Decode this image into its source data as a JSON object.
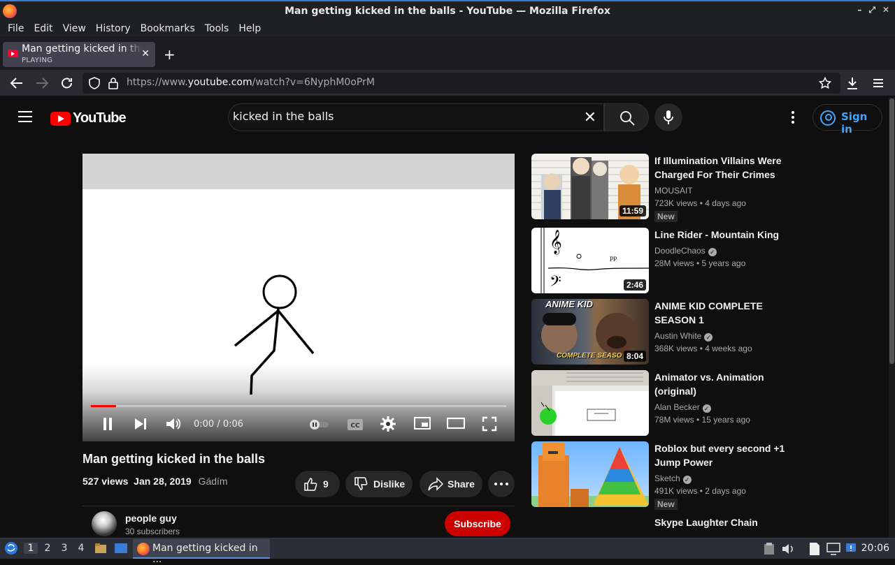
{
  "window": {
    "title": "Man getting kicked in the balls - YouTube — Mozilla Firefox",
    "controls": [
      "–",
      "⤢",
      "✕"
    ]
  },
  "menubar": [
    {
      "label": "File"
    },
    {
      "label": "Edit"
    },
    {
      "label": "View"
    },
    {
      "label": "History"
    },
    {
      "label": "Bookmarks"
    },
    {
      "label": "Tools"
    },
    {
      "label": "Help"
    }
  ],
  "tab": {
    "title": "Man getting kicked in the balls - YouTube",
    "status": "PLAYING",
    "close": "✕",
    "new_tab": "+"
  },
  "navbar": {
    "url_prefix": "https://www.",
    "url_domain": "youtube.com",
    "url_path": "/watch?v=6NyphM0oPrM"
  },
  "youtube": {
    "logo_text": "YouTube",
    "search_value": "kicked in the balls",
    "search_placeholder": "Search",
    "clear": "✕",
    "signin": "Sign in"
  },
  "player": {
    "time": "0:00 / 0:06",
    "progress": 0.06
  },
  "video": {
    "title": "Man getting kicked in the balls",
    "views": "527 views",
    "date": "Jan 28, 2019",
    "tag": "Gádím",
    "likes": "9",
    "dislike": "Dislike",
    "share": "Share"
  },
  "channel": {
    "name": "people guy",
    "subscribers": "30 subscribers",
    "subscribe": "Subscribe"
  },
  "recommendations": [
    {
      "title": "If Illumination Villains Were Charged For Their Crimes",
      "channel": "MOUSAIT",
      "verified": false,
      "meta": "723K views • 4 days ago",
      "duration": "11:59",
      "badge": "New"
    },
    {
      "title": "Line Rider - Mountain King",
      "channel": "DoodleChaos",
      "verified": true,
      "meta": "28M views • 5 years ago",
      "duration": "2:46",
      "badge": ""
    },
    {
      "title": "ANIME KID COMPLETE SEASON 1",
      "channel": "Austin White",
      "verified": true,
      "meta": "368K views • 4 weeks ago",
      "duration": "8:04",
      "badge": "",
      "thumb_top": "ANIME KID",
      "thumb_bottom": "COMPLETE SEASO"
    },
    {
      "title": "Animator vs. Animation (original)",
      "channel": "Alan Becker",
      "verified": true,
      "meta": "78M views • 15 years ago",
      "duration": "",
      "badge": ""
    },
    {
      "title": "Roblox but every second +1 Jump Power",
      "channel": "Sketch",
      "verified": true,
      "meta": "491K views • 2 days ago",
      "duration": "",
      "badge": "New"
    },
    {
      "title": "Skype Laughter Chain",
      "channel": "",
      "verified": false,
      "meta": "",
      "duration": "",
      "badge": ""
    }
  ],
  "taskbar": {
    "workspaces": [
      "1",
      "2",
      "3",
      "4"
    ],
    "task_label": "Man getting kicked in ...",
    "clock": "20:06"
  },
  "colors": {
    "accent_red": "#ff0000",
    "link_blue": "#3ea6ff",
    "subscribe_red": "#cc0000"
  }
}
